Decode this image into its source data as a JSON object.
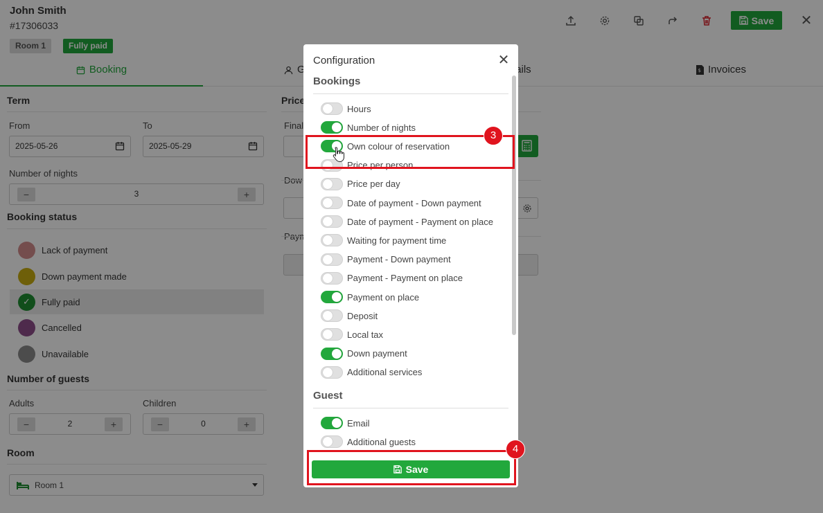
{
  "header": {
    "guest_name": "John Smith",
    "booking_id": "#17306033",
    "badge_room": "Room 1",
    "badge_status": "Fully paid",
    "save_label": "Save"
  },
  "tabs": [
    {
      "label": "Booking"
    },
    {
      "label": "G"
    },
    {
      "label": "tails"
    },
    {
      "label": "Invoices"
    }
  ],
  "term": {
    "title": "Term",
    "from_label": "From",
    "from_value": "2025-05-26",
    "to_label": "To",
    "to_value": "2025-05-29",
    "nights_label": "Number of nights",
    "nights_value": "3"
  },
  "booking_status": {
    "title": "Booking status",
    "items": [
      {
        "label": "Lack of payment",
        "color": "#d38d8d"
      },
      {
        "label": "Down payment made",
        "color": "#c9ad11"
      },
      {
        "label": "Fully paid",
        "color": "#1f8f32"
      },
      {
        "label": "Cancelled",
        "color": "#8e4d8a"
      },
      {
        "label": "Unavailable",
        "color": "#8a8a8a"
      }
    ]
  },
  "guests": {
    "title": "Number of guests",
    "adults_label": "Adults",
    "adults_value": "2",
    "children_label": "Children",
    "children_value": "0"
  },
  "room": {
    "title": "Room",
    "selected": "Room 1"
  },
  "middle": {
    "price_label": "Price",
    "final_label": "Final",
    "down_label": "Dow",
    "payment_label": "Paym"
  },
  "modal": {
    "title": "Configuration",
    "bookings_title": "Bookings",
    "bookings_options": [
      {
        "label": "Hours",
        "on": false
      },
      {
        "label": "Number of nights",
        "on": true
      },
      {
        "label": "Own colour of reservation",
        "on": true
      },
      {
        "label": "Price per person",
        "on": false
      },
      {
        "label": "Price per day",
        "on": false
      },
      {
        "label": "Date of payment - Down payment",
        "on": false
      },
      {
        "label": "Date of payment - Payment on place",
        "on": false
      },
      {
        "label": "Waiting for payment time",
        "on": false
      },
      {
        "label": "Payment - Down payment",
        "on": false
      },
      {
        "label": "Payment - Payment on place",
        "on": false
      },
      {
        "label": "Payment on place",
        "on": true
      },
      {
        "label": "Deposit",
        "on": false
      },
      {
        "label": "Local tax",
        "on": false
      },
      {
        "label": "Down payment",
        "on": true
      },
      {
        "label": "Additional services",
        "on": false
      }
    ],
    "guest_title": "Guest",
    "guest_options": [
      {
        "label": "Email",
        "on": true
      },
      {
        "label": "Additional guests",
        "on": false
      }
    ],
    "save_label": "Save"
  },
  "annotations": {
    "step3": "3",
    "step4": "4",
    "highlight_color": "#e0141e"
  }
}
